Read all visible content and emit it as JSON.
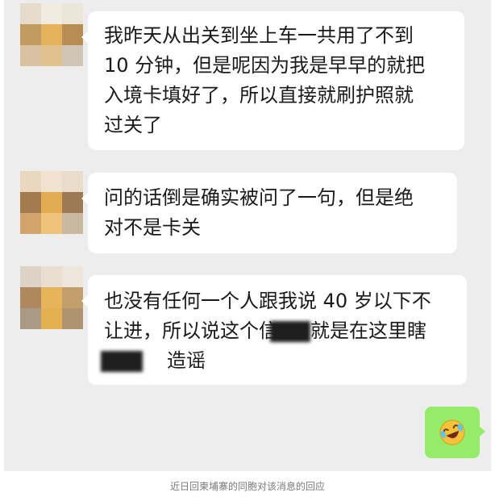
{
  "messages": [
    {
      "lines": [
        "我昨天从出关到坐上车一共用了不到",
        "10 分钟，但是呢因为我是早早的就把",
        "入境卡填好了，所以直接就刷护照就",
        "过关了"
      ]
    },
    {
      "lines": [
        "问的话倒是确实被问了一句，但是绝",
        "对不是卡关"
      ]
    },
    {
      "line1": "也没有任何一个人跟我说 40 岁以下不",
      "line2_before": "让进，所以说这个信",
      "line2_after": "就是在这里瞎",
      "line3": "造谣"
    }
  ],
  "reply": {
    "icon": "laughing-crying-emoji-icon"
  },
  "caption": "近日回柬埔寨的同胞对该消息的回应",
  "colors": {
    "chat_background": "#ededed",
    "incoming_bubble": "#ffffff",
    "outgoing_bubble": "#95ec69",
    "caption_text": "#7a7a7a"
  }
}
